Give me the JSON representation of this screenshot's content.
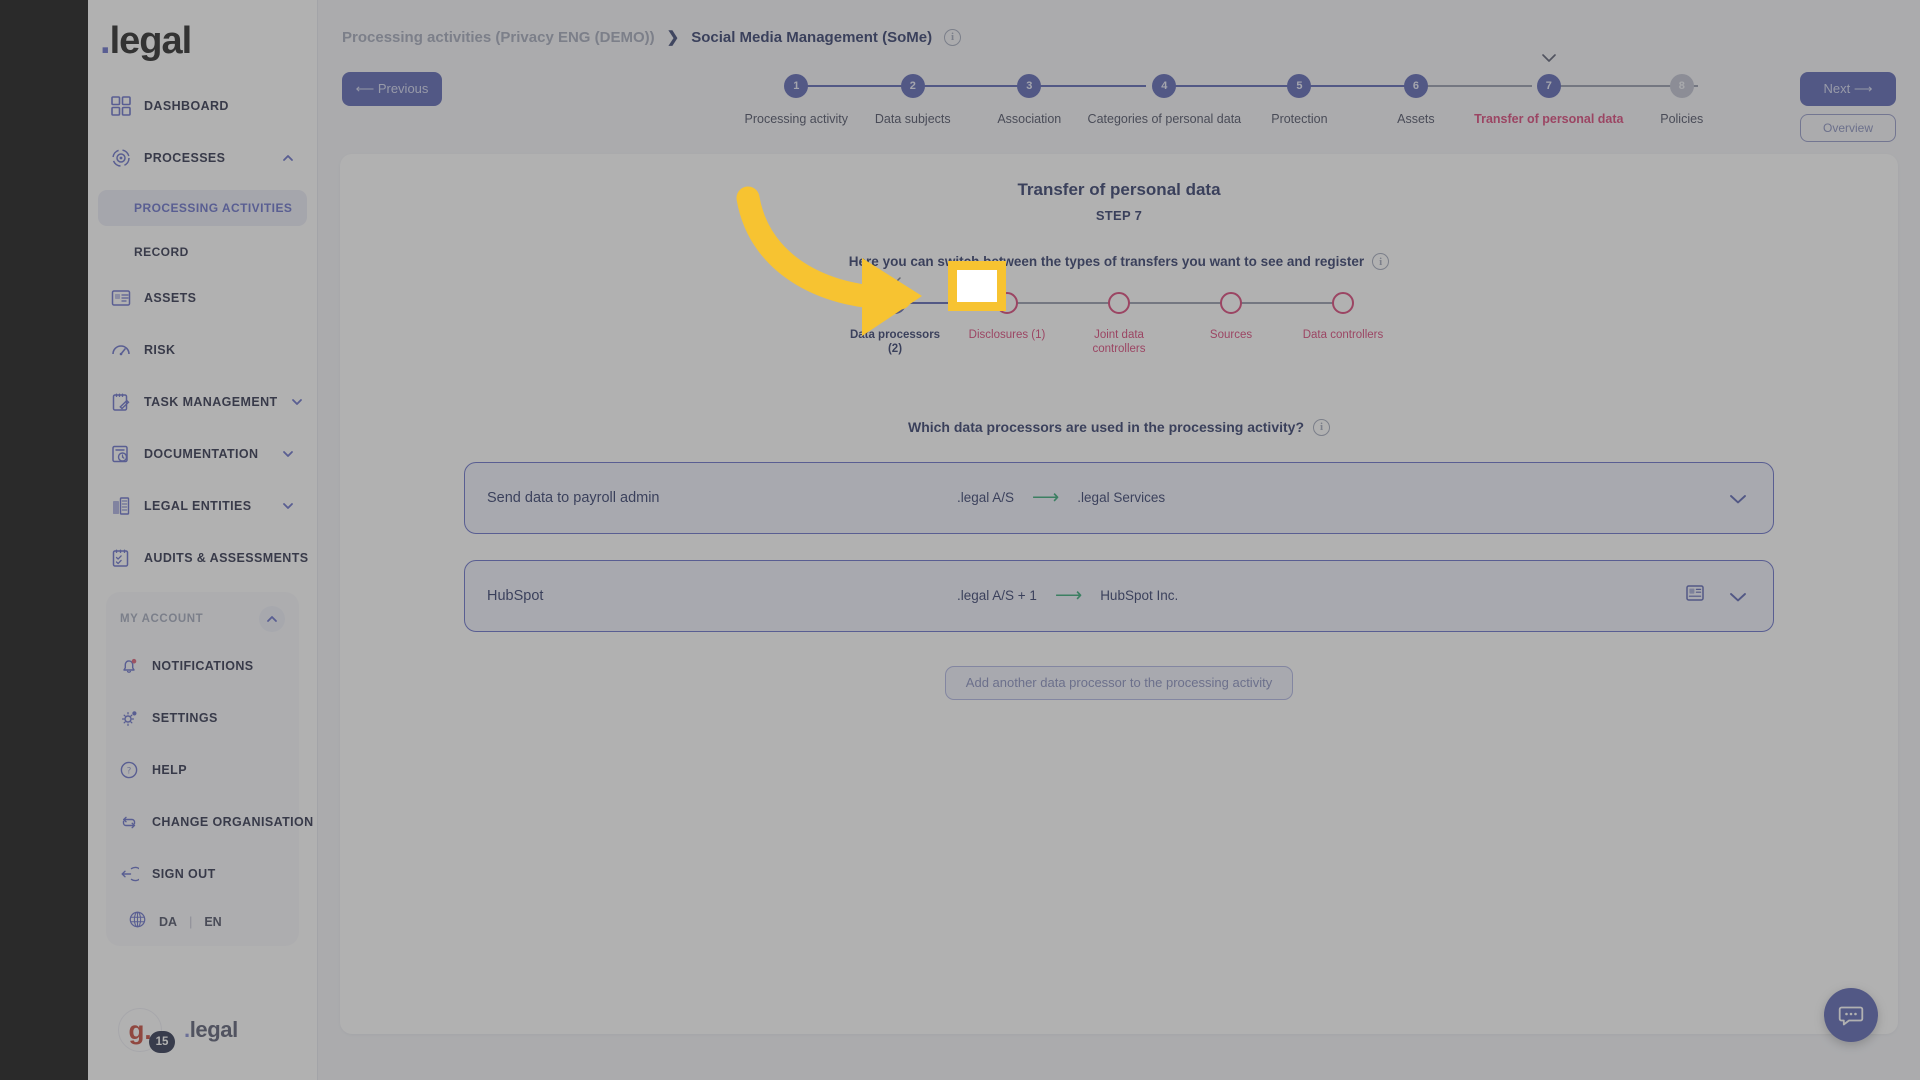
{
  "brand": {
    "dot": ".",
    "name": "legal"
  },
  "sidebar": {
    "items": [
      {
        "label": "DASHBOARD",
        "icon": "dashboard-grid-icon",
        "chevron": false
      },
      {
        "label": "PROCESSES",
        "icon": "processes-icon",
        "chevron": "up"
      },
      {
        "label": "ASSETS",
        "icon": "assets-icon",
        "chevron": false
      },
      {
        "label": "RISK",
        "icon": "risk-gauge-icon",
        "chevron": false
      },
      {
        "label": "TASK MANAGEMENT",
        "icon": "task-clipboard-icon",
        "chevron": "down"
      },
      {
        "label": "DOCUMENTATION",
        "icon": "documentation-icon",
        "chevron": "down"
      },
      {
        "label": "LEGAL ENTITIES",
        "icon": "legal-entities-icon",
        "chevron": "down"
      },
      {
        "label": "AUDITS & ASSESSMENTS",
        "icon": "audits-icon",
        "chevron": "down"
      }
    ],
    "sub_items": [
      {
        "label": "PROCESSING ACTIVITIES",
        "active": true
      },
      {
        "label": "RECORD",
        "active": false
      }
    ],
    "account": {
      "title": "MY ACCOUNT",
      "chevron": "up",
      "items": [
        {
          "label": "NOTIFICATIONS",
          "icon": "bell-icon",
          "dot": true
        },
        {
          "label": "SETTINGS",
          "icon": "gear-icon",
          "dot": true
        },
        {
          "label": "HELP",
          "icon": "question-circle-icon",
          "dot": false
        },
        {
          "label": "CHANGE ORGANISATION",
          "icon": "swap-icon",
          "dot": false
        },
        {
          "label": "SIGN OUT",
          "icon": "sign-out-icon",
          "dot": false
        }
      ],
      "languages": {
        "icon": "globe-icon",
        "first": "DA",
        "separator": "|",
        "second": "EN"
      }
    },
    "user": {
      "initial": "g.",
      "badge": "15",
      "name_dot": ".",
      "name": "legal"
    }
  },
  "breadcrumb": {
    "parent": "Processing activities (Privacy ENG (DEMO))",
    "separator": "❯",
    "current": "Social Media Management (SoMe)",
    "info_icon": "info-icon"
  },
  "wizard": {
    "previous_label": "⟵ Previous",
    "next_label": "Next ⟶",
    "overview_label": "Overview",
    "steps": [
      {
        "number": "1",
        "label": "Processing activity",
        "state": "done"
      },
      {
        "number": "2",
        "label": "Data subjects",
        "state": "done"
      },
      {
        "number": "3",
        "label": "Association",
        "state": "done"
      },
      {
        "number": "4",
        "label": "Categories of personal data",
        "state": "done"
      },
      {
        "number": "5",
        "label": "Protection",
        "state": "done"
      },
      {
        "number": "6",
        "label": "Assets",
        "state": "done"
      },
      {
        "number": "7",
        "label": "Transfer of personal data",
        "state": "current"
      },
      {
        "number": "8",
        "label": "Policies",
        "state": "pending"
      }
    ]
  },
  "card": {
    "title": "Transfer of personal data",
    "step_label": "STEP 7",
    "help_text": "Here you can switch between the types of transfers you want to see and register",
    "help_info_icon": "info-icon",
    "transfer_types": [
      {
        "label": "Data processors (2)",
        "state": "selected"
      },
      {
        "label": "Disclosures (1)",
        "state": "unselected"
      },
      {
        "label": "Joint data controllers",
        "state": "unselected"
      },
      {
        "label": "Sources",
        "state": "unselected"
      },
      {
        "label": "Data controllers",
        "state": "unselected"
      }
    ],
    "question": "Which data processors are used in the processing activity?",
    "question_info_icon": "info-icon",
    "rows": [
      {
        "name": "Send data to payroll admin",
        "from": ".legal A/S",
        "arrow": "⟶",
        "to": ".legal Services",
        "has_doc_icon": false,
        "chevron_icon": "chevron-down-icon"
      },
      {
        "name": "HubSpot",
        "from": ".legal A/S + 1",
        "arrow": "⟶",
        "to": "HubSpot Inc.",
        "has_doc_icon": true,
        "doc_icon": "document-icon",
        "chevron_icon": "chevron-down-icon"
      }
    ],
    "add_button": "Add another data processor to the processing activity"
  },
  "chat": {
    "icon": "chat-bubble-icon"
  },
  "annotation": {
    "arrow_color": "#f7c331",
    "highlight_color": "#f7c331"
  },
  "colors": {
    "accent_blue": "#4d57ad",
    "accent_pink": "#d6336c",
    "green_arrow": "#22a06b",
    "navy": "#1f2a5e",
    "page_bg": "#f3f4f8"
  }
}
